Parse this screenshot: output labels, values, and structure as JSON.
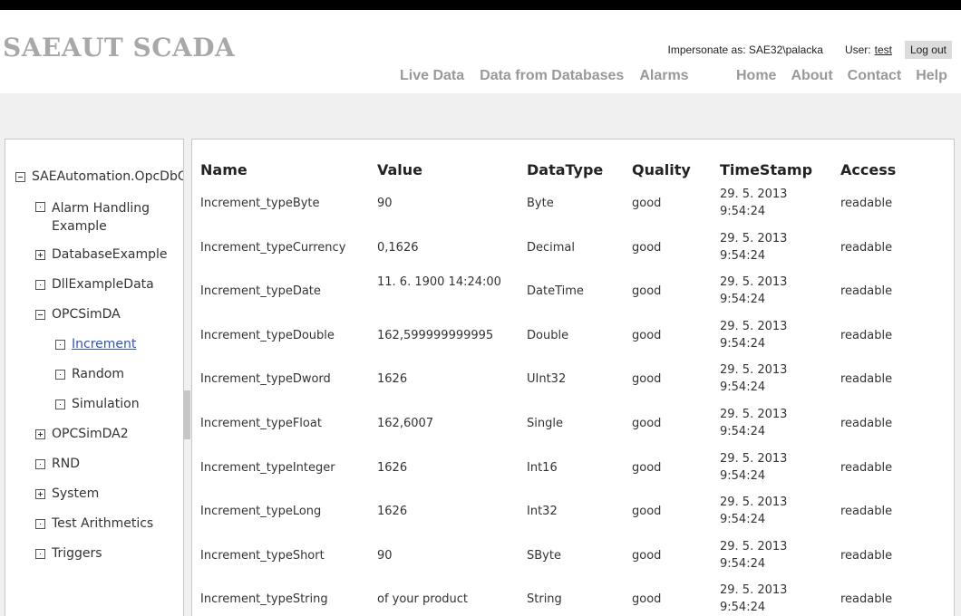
{
  "header": {
    "logo": "SAEAUT SCADA",
    "impersonate_text": "Impersonate as: SAE32\\palacka",
    "user_label": "User:",
    "user_name": "test",
    "logout_label": "Log out"
  },
  "nav": {
    "live_data": "Live Data",
    "data_from_databases": "Data from Databases",
    "alarms": "Alarms",
    "home": "Home",
    "about": "About",
    "contact": "Contact",
    "help": "Help"
  },
  "tree": {
    "root": "SAEAutomation.OpcDbGateway",
    "items": [
      {
        "label": "Alarm Handling Example",
        "icon": "leaf"
      },
      {
        "label": "DatabaseExample",
        "icon": "plus"
      },
      {
        "label": "DllExampleData",
        "icon": "leaf"
      },
      {
        "label": "OPCSimDA",
        "icon": "minus"
      },
      {
        "label": "Increment",
        "icon": "leaf",
        "selected": true
      },
      {
        "label": "Random",
        "icon": "leaf"
      },
      {
        "label": "Simulation",
        "icon": "leaf"
      },
      {
        "label": "OPCSimDA2",
        "icon": "plus"
      },
      {
        "label": "RND",
        "icon": "leaf"
      },
      {
        "label": "System",
        "icon": "plus"
      },
      {
        "label": "Test Arithmetics",
        "icon": "leaf"
      },
      {
        "label": "Triggers",
        "icon": "leaf"
      }
    ]
  },
  "table": {
    "headers": [
      "Name",
      "Value",
      "DataType",
      "Quality",
      "TimeStamp",
      "Access"
    ],
    "rows": [
      {
        "name": "Increment_typeByte",
        "value": "90",
        "type": "Byte",
        "quality": "good",
        "ts": "29. 5. 2013 9:54:24",
        "access": "readable"
      },
      {
        "name": "Increment_typeCurrency",
        "value": "0,1626",
        "type": "Decimal",
        "quality": "good",
        "ts": "29. 5. 2013 9:54:24",
        "access": "readable"
      },
      {
        "name": "Increment_typeDate",
        "value": "11. 6. 1900 14:24:00",
        "type": "DateTime",
        "quality": "good",
        "ts": "29. 5. 2013 9:54:24",
        "access": "readable"
      },
      {
        "name": "Increment_typeDouble",
        "value": "162,599999999995",
        "type": "Double",
        "quality": "good",
        "ts": "29. 5. 2013 9:54:24",
        "access": "readable"
      },
      {
        "name": "Increment_typeDword",
        "value": "1626",
        "type": "UInt32",
        "quality": "good",
        "ts": "29. 5. 2013 9:54:24",
        "access": "readable"
      },
      {
        "name": "Increment_typeFloat",
        "value": "162,6007",
        "type": "Single",
        "quality": "good",
        "ts": "29. 5. 2013 9:54:24",
        "access": "readable"
      },
      {
        "name": "Increment_typeInteger",
        "value": "1626",
        "type": "Int16",
        "quality": "good",
        "ts": "29. 5. 2013 9:54:24",
        "access": "readable"
      },
      {
        "name": "Increment_typeLong",
        "value": "1626",
        "type": "Int32",
        "quality": "good",
        "ts": "29. 5. 2013 9:54:24",
        "access": "readable"
      },
      {
        "name": "Increment_typeShort",
        "value": "90",
        "type": "SByte",
        "quality": "good",
        "ts": "29. 5. 2013 9:54:24",
        "access": "readable"
      },
      {
        "name": "Increment_typeString",
        "value": "of your product",
        "type": "String",
        "quality": "good",
        "ts": "29. 5. 2013 9:54:24",
        "access": "readable"
      }
    ]
  }
}
